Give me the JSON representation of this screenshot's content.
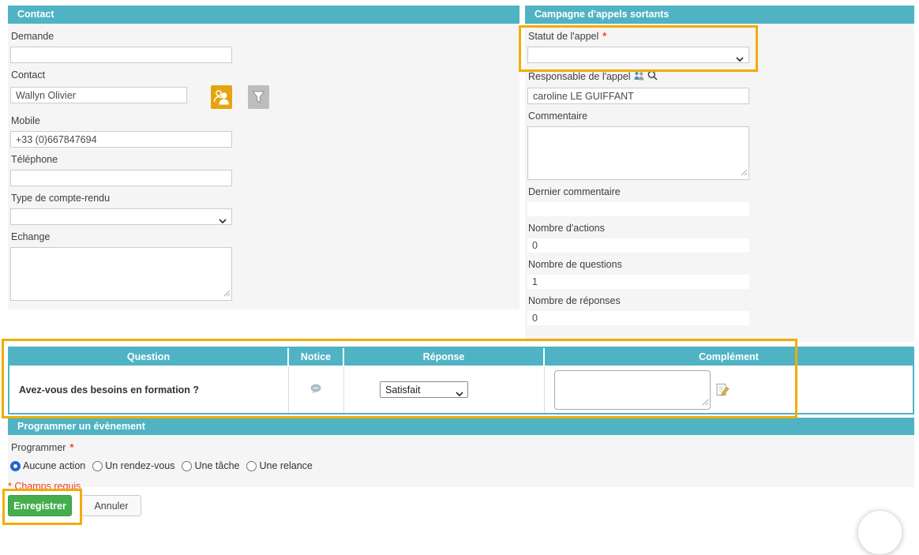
{
  "colors": {
    "teal_header": "#4fb3c4",
    "panel_bg": "#f5f5f5",
    "annotation_gold": "#f0ad00",
    "save_green": "#44ae4d",
    "required_red": "#f23c2e",
    "radio_blue": "#2065d4"
  },
  "contact_panel": {
    "title": "Contact",
    "demande": {
      "label": "Demande",
      "value": ""
    },
    "contact": {
      "label": "Contact",
      "value": "Wallyn Olivier"
    },
    "mobile": {
      "label": "Mobile",
      "value": "+33 (0)667847694"
    },
    "telephone": {
      "label": "Téléphone",
      "value": ""
    },
    "type_compte_rendu": {
      "label": "Type de compte-rendu",
      "value": ""
    },
    "echange": {
      "label": "Echange",
      "value": ""
    }
  },
  "campaign_panel": {
    "title": "Campagne d'appels sortants",
    "statut": {
      "label": "Statut de l'appel",
      "value": ""
    },
    "responsable": {
      "label": "Responsable de l'appel",
      "value": "caroline LE GUIFFANT"
    },
    "commentaire": {
      "label": "Commentaire",
      "value": ""
    },
    "dernier_commentaire": {
      "label": "Dernier commentaire",
      "value": ""
    },
    "nombre_actions": {
      "label": "Nombre d'actions",
      "value": "0"
    },
    "nombre_questions": {
      "label": "Nombre de questions",
      "value": "1"
    },
    "nombre_reponses": {
      "label": "Nombre de réponses",
      "value": "0"
    }
  },
  "question_table": {
    "headers": [
      "Question",
      "Notice",
      "Réponse",
      "Complément"
    ],
    "rows": [
      {
        "question": "Avez-vous des besoins en formation ?",
        "reponse": "Satisfait",
        "complement": ""
      }
    ]
  },
  "event_panel": {
    "title": "Programmer un évènement",
    "programmer_label": "Programmer",
    "options": [
      {
        "label": "Aucune action",
        "selected": true
      },
      {
        "label": "Un rendez-vous",
        "selected": false
      },
      {
        "label": "Une tâche",
        "selected": false
      },
      {
        "label": "Une relance",
        "selected": false
      }
    ]
  },
  "footer": {
    "required_note": "* Champs requis",
    "save_label": "Enregistrer",
    "cancel_label": "Annuler"
  },
  "misc": {
    "required_marker": "*"
  },
  "icons": {
    "contact_lookup": "contacts-icon",
    "contact_filter": "filter-icon",
    "responsable_people": "people-icon",
    "responsable_search": "search-icon",
    "notice": "comment-bubble-icon",
    "complement_edit": "edit-note-icon"
  }
}
